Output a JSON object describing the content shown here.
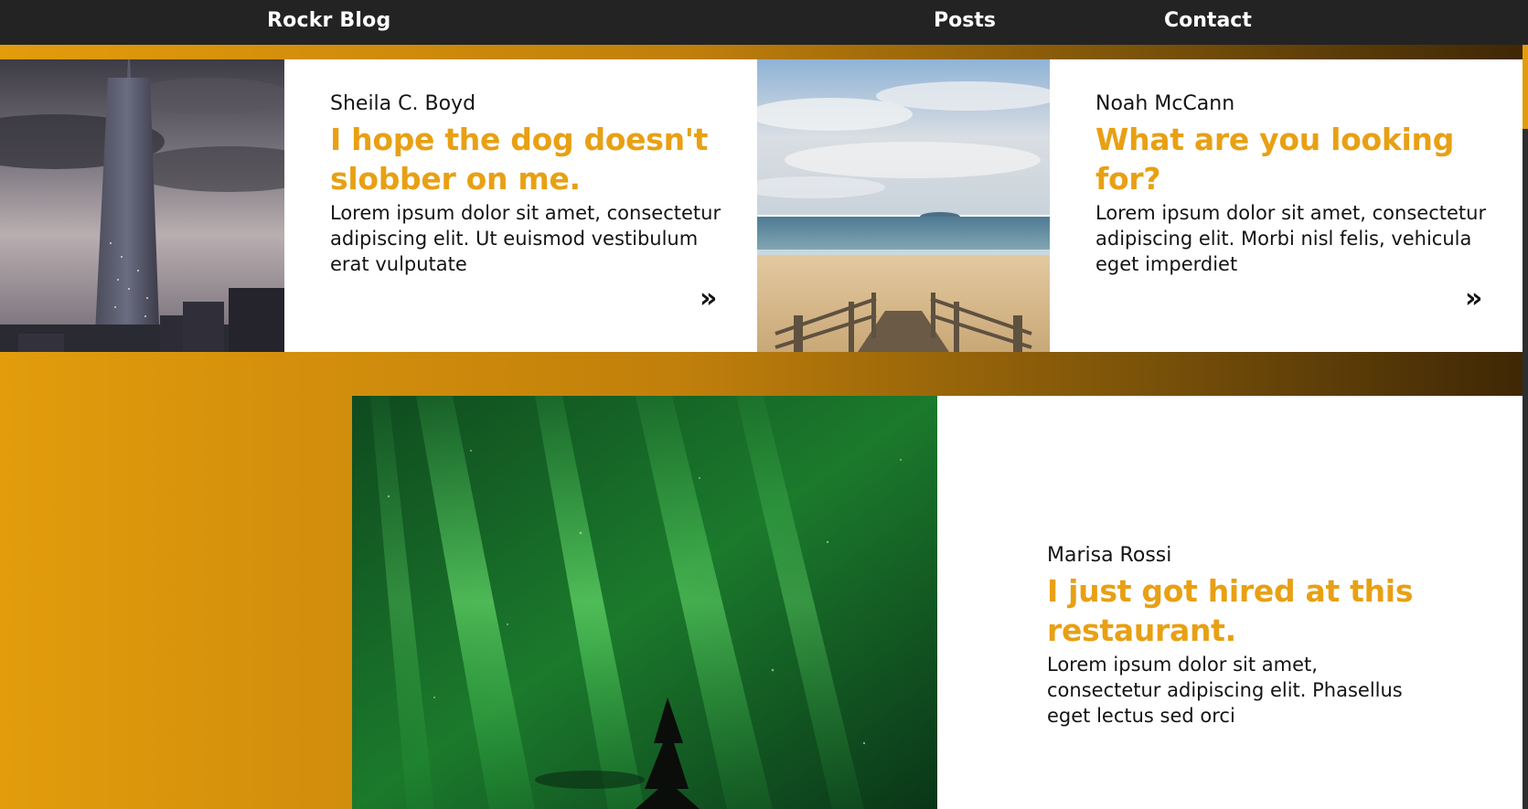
{
  "nav": {
    "brand": "Rockr Blog",
    "links": [
      {
        "label": "Posts"
      },
      {
        "label": "Contact"
      }
    ]
  },
  "colors": {
    "accent": "#E8A014",
    "nav_background": "#232323",
    "card_background": "#ffffff",
    "text": "#141414"
  },
  "posts": [
    {
      "image": "city skyscraper at dusk",
      "author": "Sheila C. Boyd",
      "title": "I hope the dog doesn't slobber on me.",
      "excerpt": "Lorem ipsum dolor sit amet, consectetur adipiscing elit. Ut euismod vestibulum erat vulputate",
      "more_icon": "double-chevron-right",
      "more_label": "»"
    },
    {
      "image": "beach with wooden boardwalk",
      "author": "Noah McCann",
      "title": "What are you looking for?",
      "excerpt": "Lorem ipsum dolor sit amet, consectetur adipiscing elit. Morbi nisl felis, vehicula eget imperdiet",
      "more_icon": "double-chevron-right",
      "more_label": "»"
    },
    {
      "image": "green aurora over tree silhouette",
      "author": "Marisa Rossi",
      "title": "I just got hired at this restaurant.",
      "excerpt": "Lorem ipsum dolor sit amet, consectetur adipiscing elit. Phasellus eget lectus sed orci"
    }
  ]
}
